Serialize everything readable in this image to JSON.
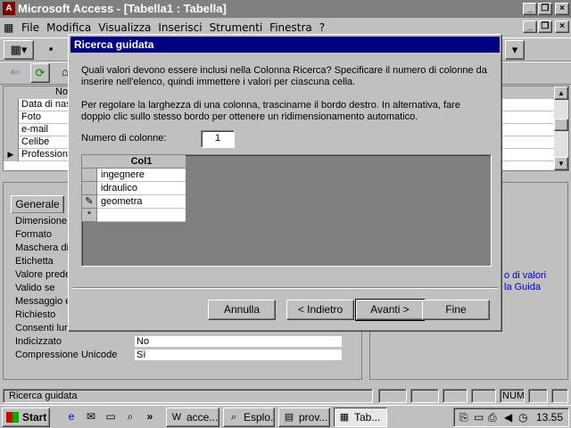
{
  "app": {
    "title": "Microsoft Access - [Tabella1 : Tabella]",
    "icon_label": "A"
  },
  "menu": {
    "items": [
      "File",
      "Modifica",
      "Visualizza",
      "Inserisci",
      "Strumenti",
      "Finestra",
      "?"
    ]
  },
  "grid": {
    "header": "No",
    "rows": [
      "Data di nas",
      "Foto",
      "e-mail",
      "Celibe",
      "Professione"
    ]
  },
  "props": {
    "tab_label": "Generale",
    "labels": [
      "Dimensione c",
      "Formato",
      "Maschera di",
      "Etichetta",
      "Valore prede",
      "Valido se",
      "Messaggio e",
      "Richiesto",
      "Consenti lun",
      "Indicizzato",
      "Compressione Unicode"
    ],
    "indicizzato_value": "No",
    "unicode_value": "Sì"
  },
  "help": {
    "text_line1": "o di valori",
    "text_line2": "la Guida"
  },
  "dialog": {
    "title": "Ricerca guidata",
    "para1": "Quali valori devono essere inclusi nella Colonna Ricerca? Specificare il numero di colonne da inserire nell'elenco, quindi immettere i valori per ciascuna cella.",
    "para2": "Per regolare la larghezza di una colonna, trascinarne il bordo destro. In alternativa, fare doppio clic sullo stesso bordo per ottenere un ridimensionamento automatico.",
    "ncol_label": "Numero di colonne:",
    "ncol_value": "1",
    "column_header": "Col1",
    "values": [
      "ingegnere",
      "idraulico",
      "geometra"
    ],
    "new_row_marker": "*",
    "edit_marker": "✎",
    "buttons": {
      "cancel": "Annulla",
      "back": "< Indietro",
      "next": "Avanti >",
      "finish": "Fine"
    }
  },
  "status": {
    "text": "Ricerca guidata",
    "num": "NUM"
  },
  "taskbar": {
    "start": "Start",
    "tasks": [
      "acce...",
      "Esplo...",
      "prov...",
      "Tab..."
    ],
    "clock": "13.55"
  }
}
